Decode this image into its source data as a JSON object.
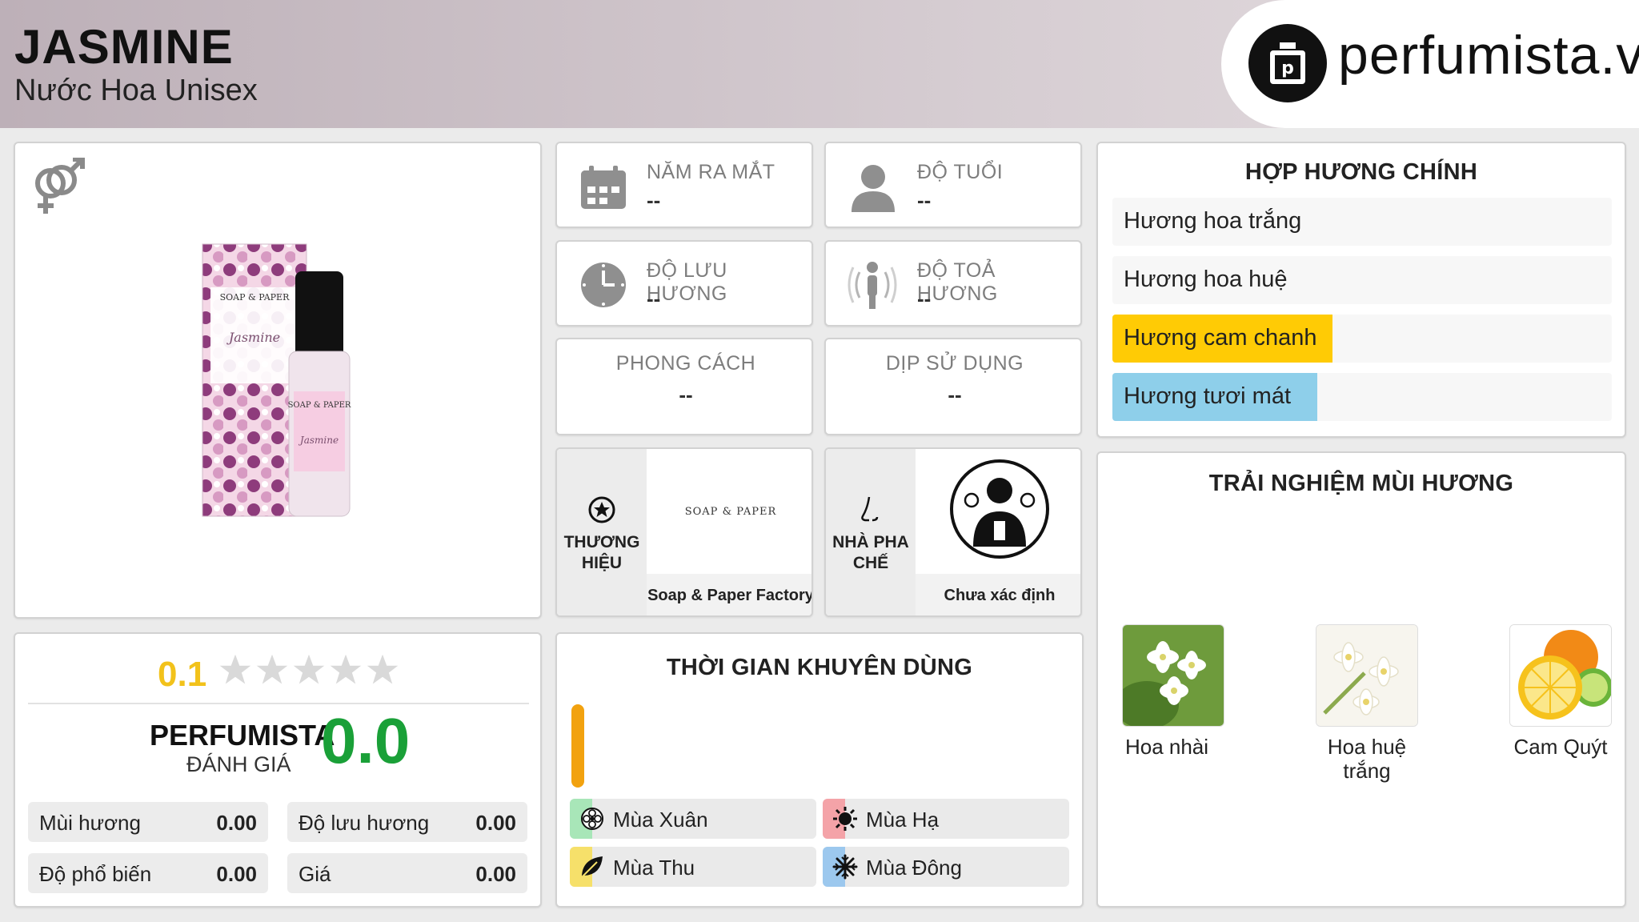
{
  "header": {
    "title": "JASMINE",
    "subtitle": "Nước Hoa Unisex",
    "logo_text": "perfumista.vn"
  },
  "product": {
    "gender_icon": "unisex-icon",
    "box_brand": "SOAP & PAPER",
    "box_name": "Jasmine"
  },
  "info": {
    "launch_year": {
      "label": "NĂM RA MẮT",
      "value": "--"
    },
    "age": {
      "label": "ĐỘ TUỔI",
      "value": "--"
    },
    "longevity": {
      "label": "ĐỘ LƯU HƯƠNG",
      "value": "--"
    },
    "sillage": {
      "label": "ĐỘ TOẢ HƯƠNG",
      "value": "--"
    },
    "style": {
      "label": "PHONG CÁCH",
      "value": "--"
    },
    "occasion": {
      "label": "DỊP SỬ DỤNG",
      "value": "--"
    },
    "brand": {
      "label_1": "THƯƠNG",
      "label_2": "HIỆU",
      "name": "Soap & Paper Factory",
      "logo_text": "SOAP & PAPER"
    },
    "perfumer": {
      "label_1": "NHÀ PHA",
      "label_2": "CHẾ",
      "name": "Chưa xác định"
    }
  },
  "accords": {
    "title": "HỢP HƯƠNG CHÍNH",
    "items": [
      {
        "label": "Hương hoa trắng",
        "fill": 0,
        "color": "#ffffff"
      },
      {
        "label": "Hương hoa huệ",
        "fill": 0,
        "color": "#f4f0fb"
      },
      {
        "label": "Hương cam chanh",
        "fill": 0.44,
        "color": "#ffcb05"
      },
      {
        "label": "Hương tươi mát",
        "fill": 0.41,
        "color": "#8ecfea"
      }
    ]
  },
  "notes": {
    "title": "TRẢI NGHIỆM MÙI HƯƠNG",
    "items": [
      {
        "label": "Hoa nhài"
      },
      {
        "label_1": "Hoa huệ",
        "label_2": "trắng"
      },
      {
        "label": "Cam Quýt"
      }
    ]
  },
  "rating": {
    "user_score": "0.1",
    "stars": 5,
    "perfumista_label": "PERFUMISTA",
    "review_label": "ĐÁNH GIÁ",
    "perfumista_score": "0.0",
    "metrics": [
      {
        "label": "Mùi hương",
        "value": "0.00"
      },
      {
        "label": "Độ lưu hương",
        "value": "0.00"
      },
      {
        "label": "Độ phổ biến",
        "value": "0.00"
      },
      {
        "label": "Giá",
        "value": "0.00"
      }
    ]
  },
  "recommended_time": {
    "title": "THỜI GIAN KHUYÊN DÙNG",
    "seasons": [
      {
        "label": "Mùa Xuân",
        "color": "#a8e6b8",
        "icon": "flower-icon"
      },
      {
        "label": "Mùa Hạ",
        "color": "#f4a3a8",
        "icon": "sun-icon"
      },
      {
        "label": "Mùa Thu",
        "color": "#f6e06a",
        "icon": "leaf-icon"
      },
      {
        "label": "Mùa Đông",
        "color": "#9cc8ee",
        "icon": "snowflake-icon"
      }
    ]
  }
}
